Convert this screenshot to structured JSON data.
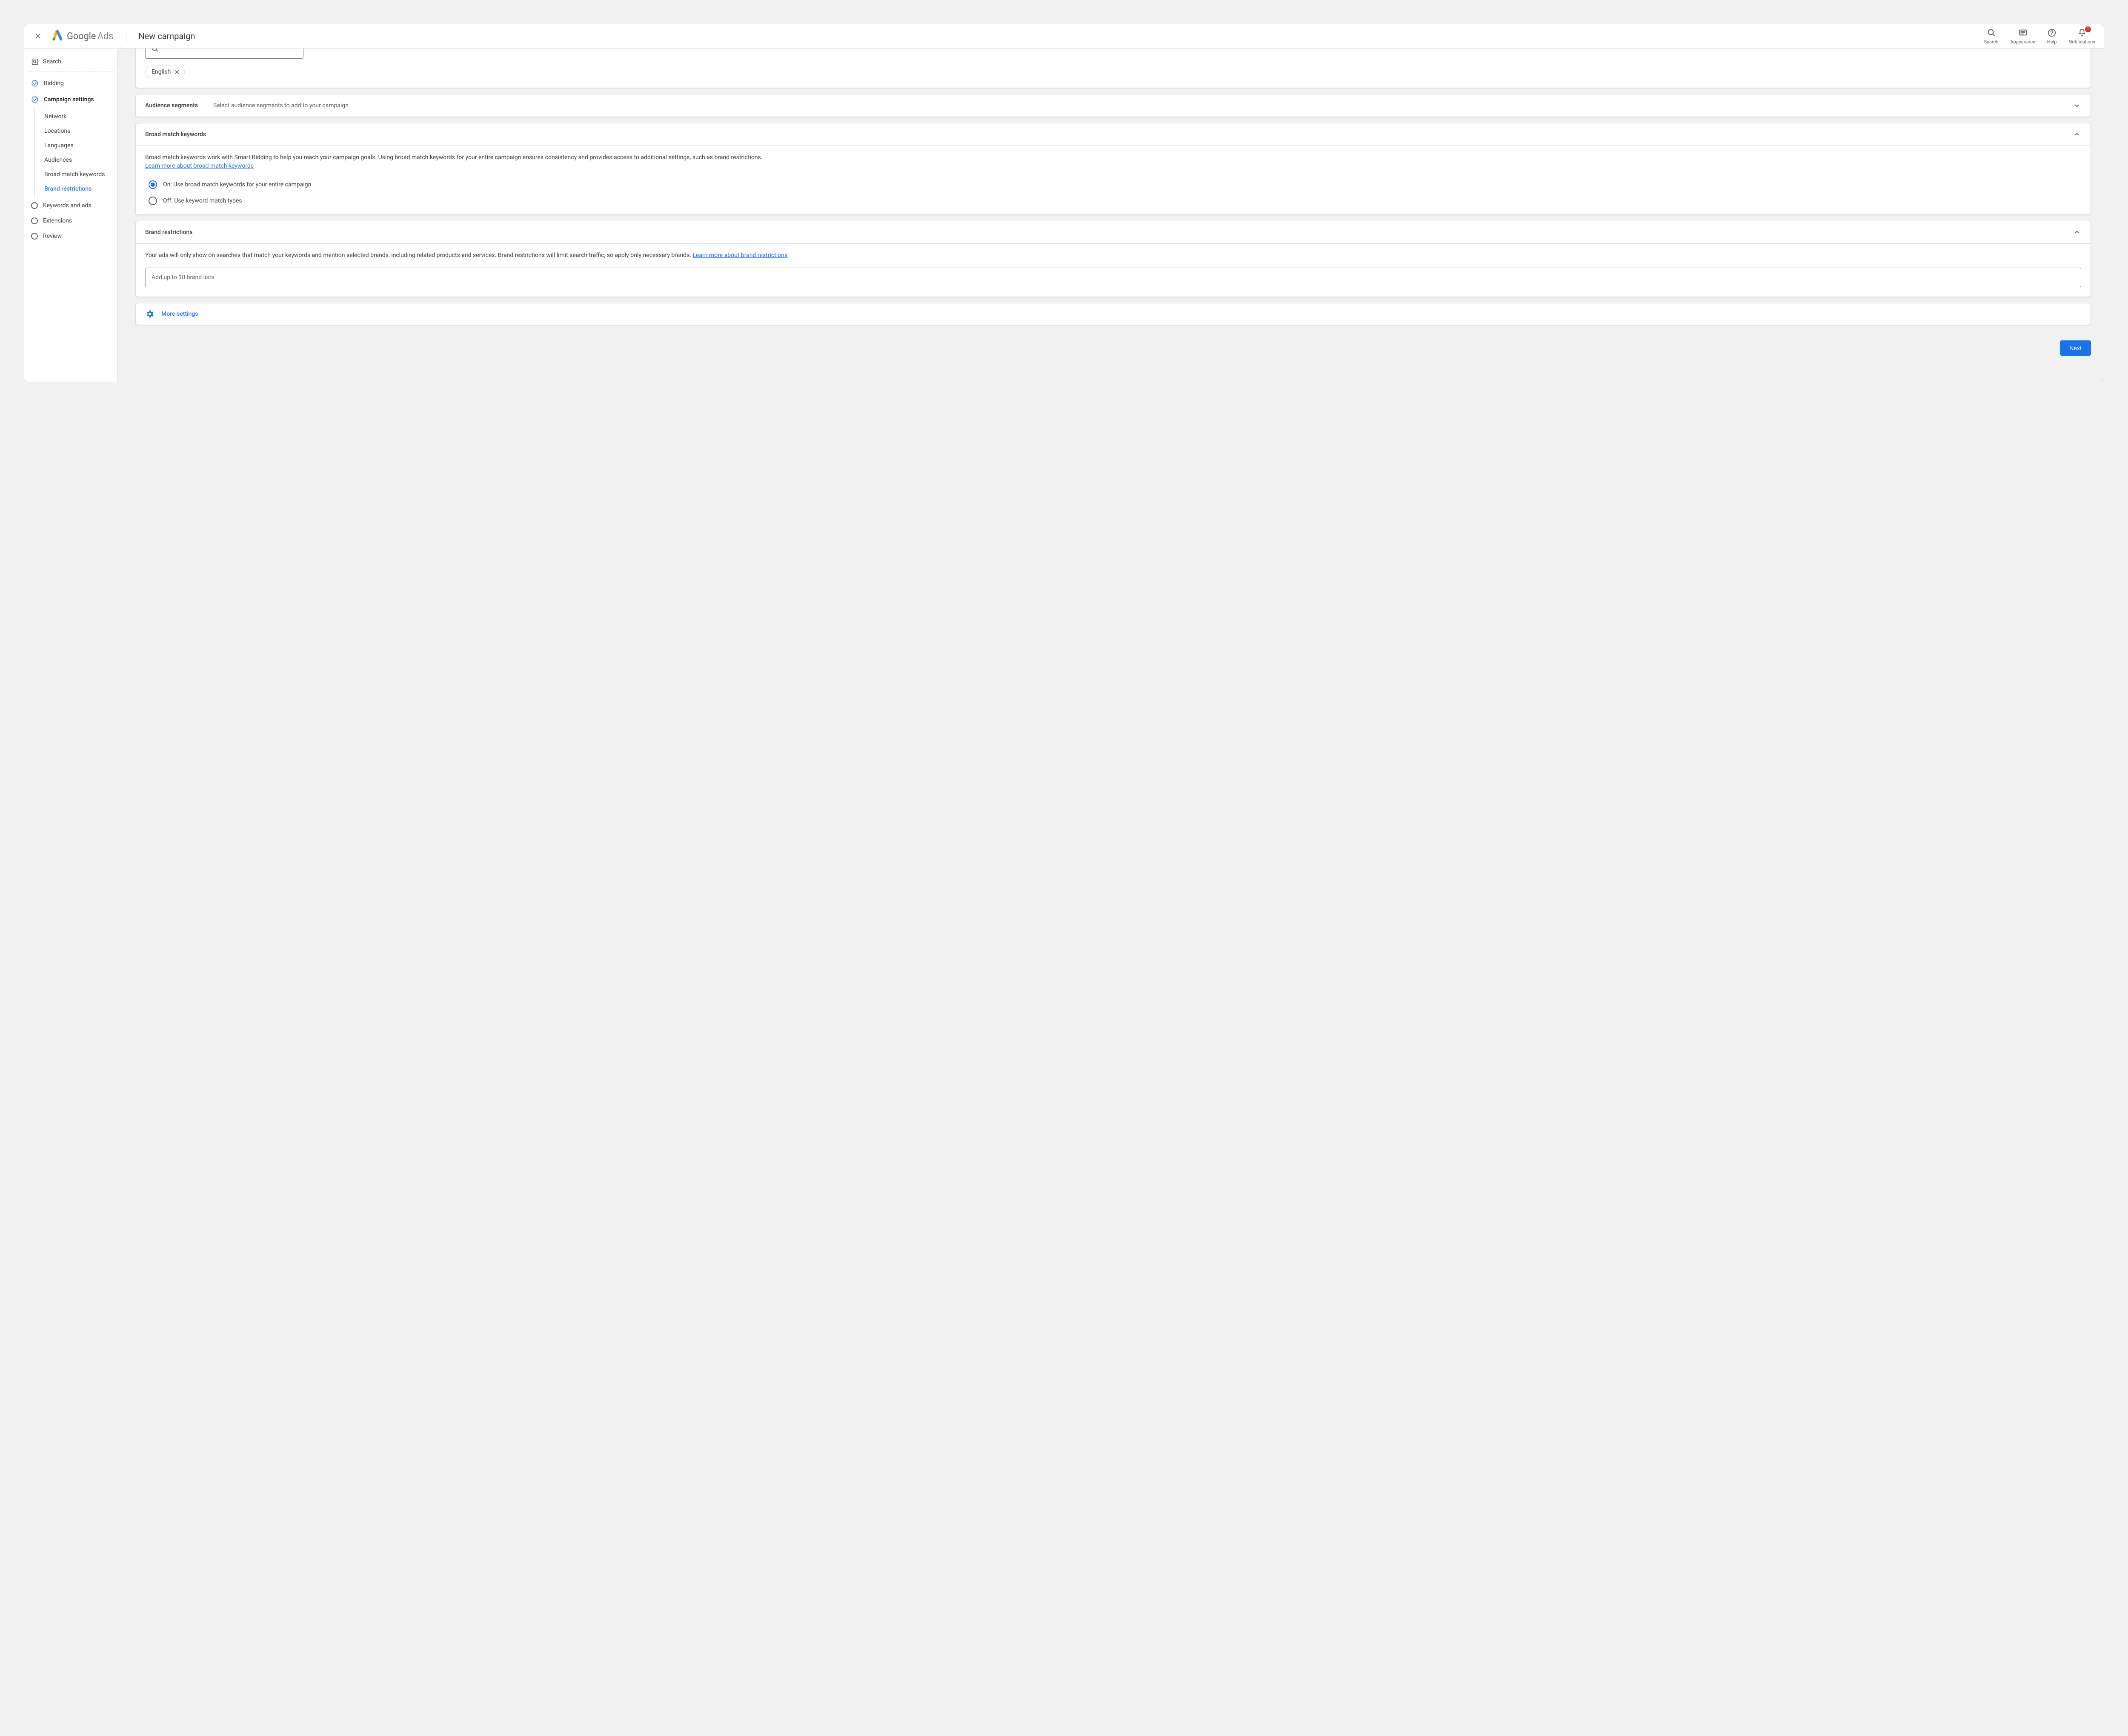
{
  "header": {
    "brand1": "Google",
    "brand2": "Ads",
    "page_title": "New campaign",
    "actions": {
      "search": "Search",
      "appearance": "Appearance",
      "help": "Help",
      "notifications": "Notifications"
    }
  },
  "sidebar": {
    "search": "Search",
    "steps": [
      {
        "label": "Bidding",
        "state": "completed"
      },
      {
        "label": "Campaign settings",
        "state": "current",
        "substeps": [
          {
            "label": "Network"
          },
          {
            "label": "Locations"
          },
          {
            "label": "Languages"
          },
          {
            "label": "Audiences"
          },
          {
            "label": "Broad match keywords"
          },
          {
            "label": "Brand restrictions",
            "active": true
          }
        ]
      },
      {
        "label": "Keywords and ads",
        "state": "pending"
      },
      {
        "label": "Extensions",
        "state": "pending"
      },
      {
        "label": "Review",
        "state": "pending"
      }
    ]
  },
  "main": {
    "languages": {
      "chip": "English"
    },
    "audience": {
      "title": "Audience segments",
      "subtitle": "Select audience segments to add to your campaign"
    },
    "broad": {
      "title": "Broad match keywords",
      "desc": "Broad match keywords work with Smart Bidding to help you reach your campaign goals. Using broad match keywords for your entire campaign ensures consistency and provides access to additional settings, such as brand restrictions.",
      "learn": "Learn more about broad match keywords",
      "option_on": "On: Use broad match keywords for your entire campaign",
      "option_off": "Off: Use keyword match types"
    },
    "brand": {
      "title": "Brand restrictions",
      "desc": "Your ads will only show on searches that match your keywords and mention selected brands, including related products and services. Brand restrictions will limit search traffic, so apply only necessary brands.  ",
      "learn": "Learn more about brand restrictions",
      "placeholder": "Add up to 10 brand lists"
    },
    "more_settings": "More settings",
    "next": "Next"
  }
}
